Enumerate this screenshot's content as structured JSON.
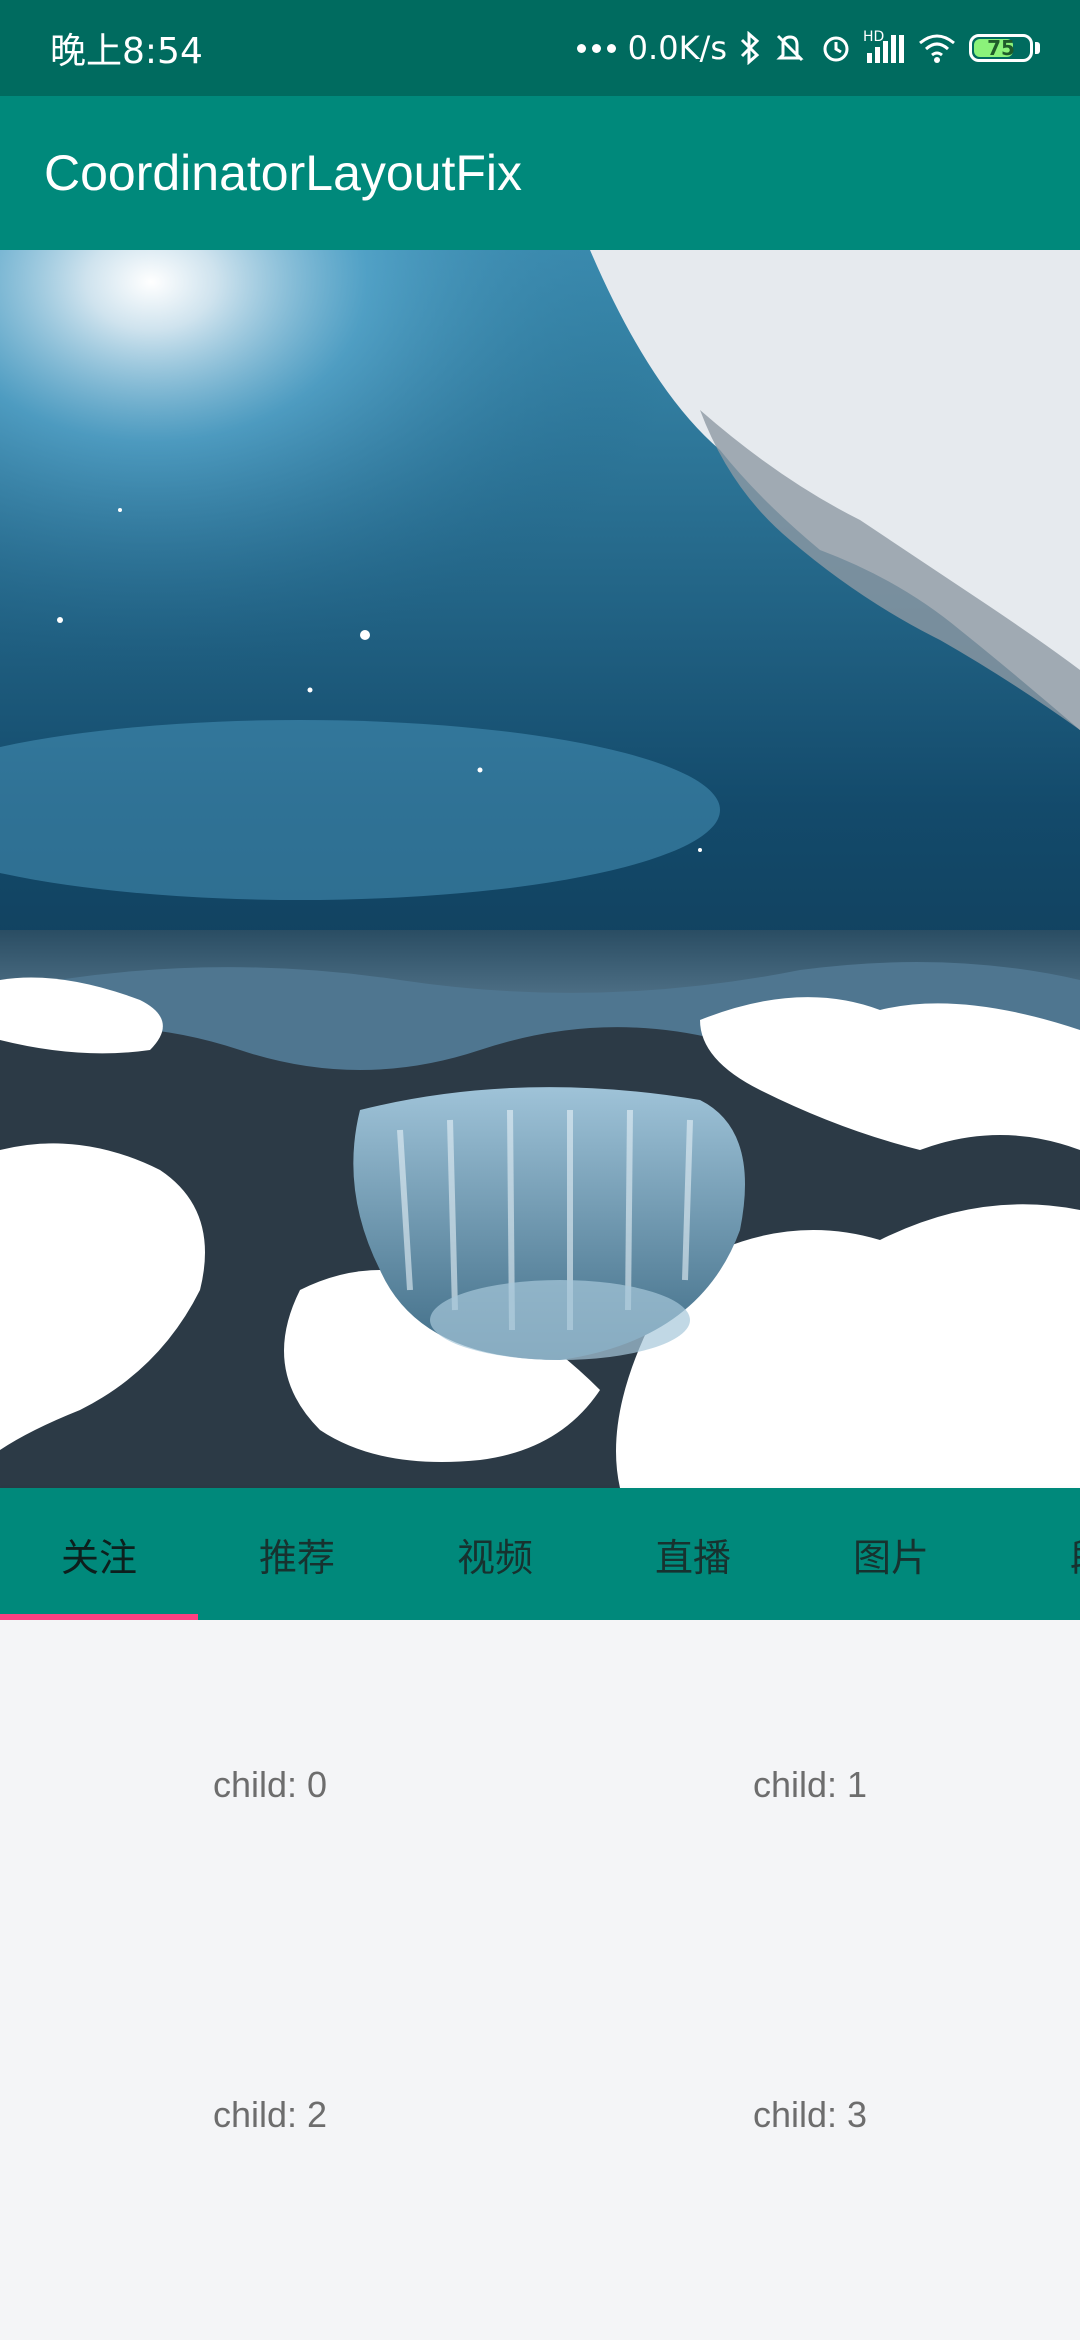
{
  "status_bar": {
    "time": "晚上8:54",
    "net_speed": "0.0K/s",
    "signal_label": "HD",
    "battery_level": "75",
    "icons": [
      "bluetooth-icon",
      "mute-icon",
      "alarm-icon",
      "signal-icon",
      "wifi-icon",
      "battery-icon"
    ]
  },
  "app_bar": {
    "title": "CoordinatorLayoutFix"
  },
  "header_image": {
    "icon": "waterfall-landscape-image"
  },
  "tabs": [
    {
      "label": "关注",
      "active": true
    },
    {
      "label": "推荐",
      "active": false
    },
    {
      "label": "视频",
      "active": false
    },
    {
      "label": "直播",
      "active": false
    },
    {
      "label": "图片",
      "active": false
    },
    {
      "label": "段",
      "active": false
    }
  ],
  "grid_items": [
    {
      "label": "child: 0"
    },
    {
      "label": "child: 1"
    },
    {
      "label": "child: 2"
    },
    {
      "label": "child: 3"
    }
  ],
  "colors": {
    "status_bar": "#006b5f",
    "primary": "#00897b",
    "accent": "#ff4081"
  }
}
